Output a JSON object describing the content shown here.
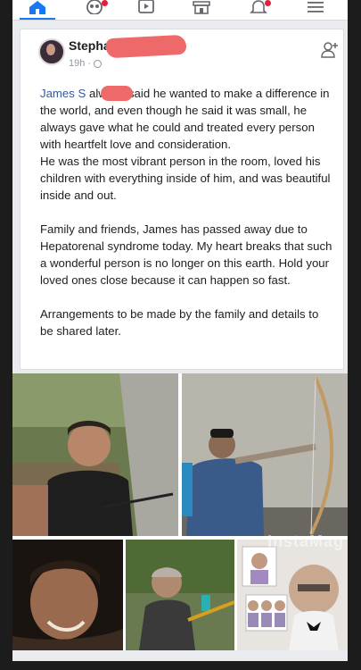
{
  "nav": {
    "items": [
      {
        "name": "home",
        "icon": "home-icon",
        "active": true
      },
      {
        "name": "friends",
        "icon": "friends-icon",
        "badge": true
      },
      {
        "name": "watch",
        "icon": "watch-icon"
      },
      {
        "name": "marketplace",
        "icon": "marketplace-icon"
      },
      {
        "name": "notifications",
        "icon": "bell-icon",
        "badge": true
      },
      {
        "name": "menu",
        "icon": "menu-icon"
      }
    ],
    "accent": "#1877f2"
  },
  "post": {
    "author": "Stepha",
    "timestamp": "19h ·",
    "mention": "James S",
    "paragraphs": [
      "always said he wanted to make a difference in the world, and even though he said it was small, he always gave what he could and treated every person with heartfelt love and consideration.",
      "He was the most vibrant person in the room, loved his children with everything inside of him, and was beautiful inside and out.",
      "Family and friends, James has passed away due to Hepatorenal syndrome today. My heart breaks that such a wonderful person is no longer on this earth. Hold your loved ones close because it can happen so fast.",
      "Arrangements to be made by the family and details to be shared later."
    ]
  },
  "photos": {
    "watermark": "InstaMag"
  },
  "colors": {
    "redaction": "#ee6a6a",
    "link": "#385898"
  }
}
